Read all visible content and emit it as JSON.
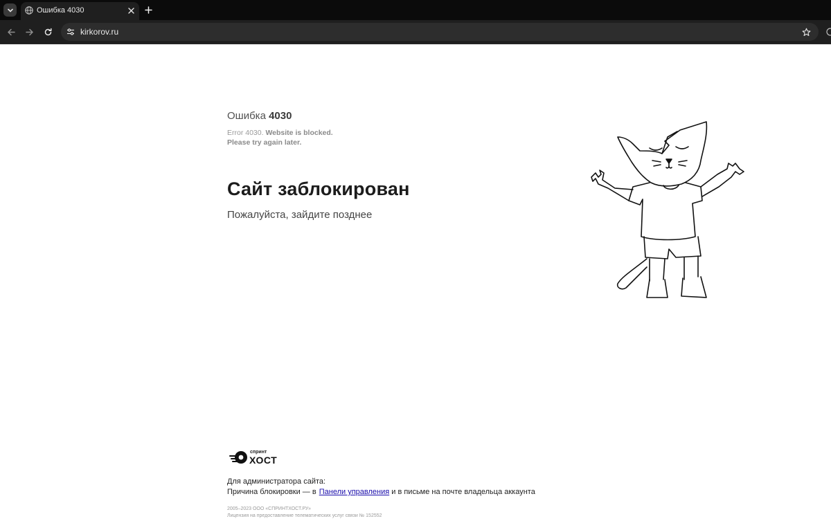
{
  "browser": {
    "tab": {
      "title": "Ошибка 4030",
      "favicon": "globe-icon"
    },
    "url": "kirkorov.ru",
    "icons": {
      "tab_search": "chevron-down-icon",
      "close_tab": "close-icon",
      "new_tab": "plus-icon",
      "back": "arrow-left-icon",
      "forward": "arrow-right-icon",
      "reload": "reload-icon",
      "site_info": "tune-icon",
      "bookmark": "star-icon"
    },
    "colors": {
      "tabbar": "#0b0b0b",
      "toolbar": "#1f1f1f",
      "omnibox": "#2d2d2d"
    }
  },
  "page": {
    "error_label": "Ошибка",
    "error_number": "4030",
    "error_en_prefix": "Error 4030.",
    "error_en_bold_1": "Website is blocked.",
    "error_en_bold_2": "Please try again later.",
    "headline": "Сайт заблокирован",
    "subline": "Пожалуйста, зайдите позднее",
    "illustration": "cat-shrug-illustration",
    "footer": {
      "logo_top": "спринт",
      "logo_bottom": "ХОСТ",
      "admin_title": "Для администратора сайта:",
      "reason_prefix": "Причина блокировки — в",
      "reason_link": "Панели управления",
      "reason_suffix": "и в письме на почте владельца аккаунта",
      "copyright_1": "2005–2023 ООО «СПРИНТХОСТ.РУ»",
      "copyright_2": "Лицензия на предоставление телематических услуг связи № 152552"
    },
    "colors": {
      "link": "#1a0dab",
      "headline": "#1c1c1c"
    }
  }
}
